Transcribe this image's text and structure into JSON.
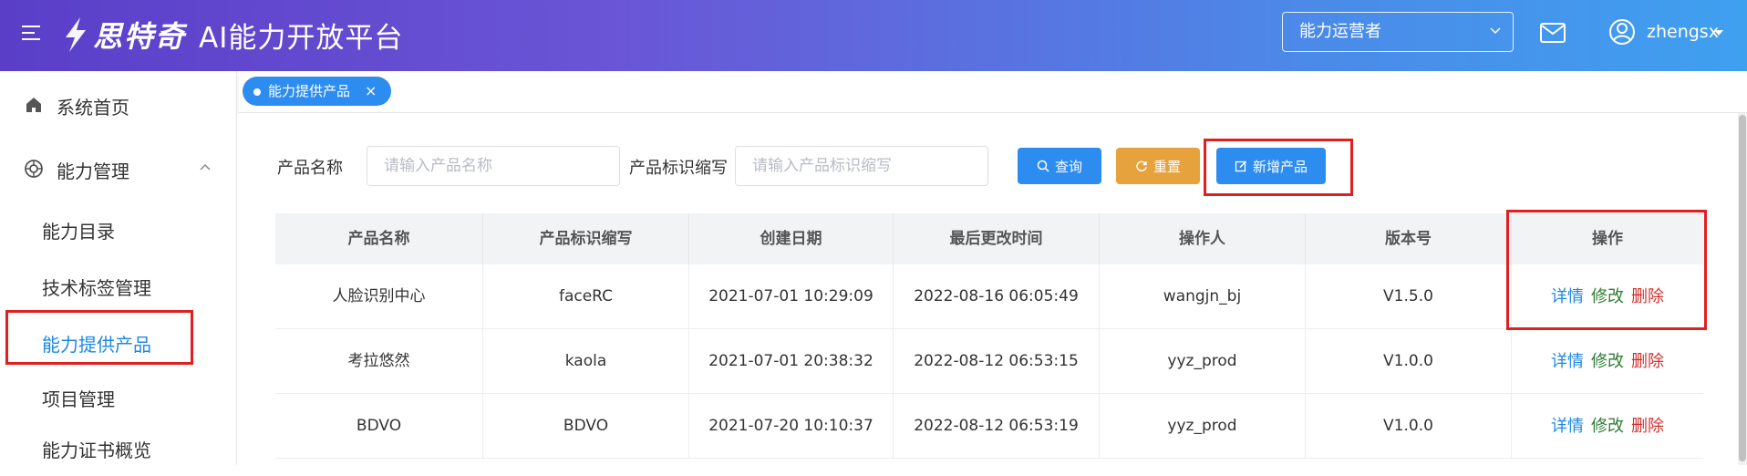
{
  "header": {
    "brand": "思特奇",
    "platform": "AI能力开放平台",
    "role_select": "能力运营者",
    "username": "zhengsx"
  },
  "sidebar": {
    "items": [
      {
        "label": "系统首页",
        "icon": "home-icon"
      },
      {
        "label": "能力管理",
        "icon": "capability-icon"
      }
    ],
    "sub_items": [
      {
        "label": "能力目录"
      },
      {
        "label": "技术标签管理"
      },
      {
        "label": "能力提供产品"
      },
      {
        "label": "项目管理"
      },
      {
        "label": "能力证书概览"
      }
    ]
  },
  "tabs": [
    {
      "label": "能力提供产品",
      "close": "×"
    }
  ],
  "search": {
    "name_label": "产品名称",
    "name_placeholder": "请输入产品名称",
    "abbr_label": "产品标识缩写",
    "abbr_placeholder": "请输入产品标识缩写",
    "query_btn": "查询",
    "reset_btn": "重置",
    "add_btn": "新增产品"
  },
  "table": {
    "columns": [
      "产品名称",
      "产品标识缩写",
      "创建日期",
      "最后更改时间",
      "操作人",
      "版本号",
      "操作"
    ],
    "rows": [
      {
        "name": "人脸识别中心",
        "abbr": "faceRC",
        "created": "2021-07-01 10:29:09",
        "modified": "2022-08-16 06:05:49",
        "operator": "wangjn_bj",
        "version": "V1.5.0"
      },
      {
        "name": "考拉悠然",
        "abbr": "kaola",
        "created": "2021-07-01 20:38:32",
        "modified": "2022-08-12 06:53:15",
        "operator": "yyz_prod",
        "version": "V1.0.0"
      },
      {
        "name": "BDVO",
        "abbr": "BDVO",
        "created": "2021-07-20 10:10:37",
        "modified": "2022-08-12 06:53:19",
        "operator": "yyz_prod",
        "version": "V1.0.0"
      }
    ],
    "actions": {
      "detail": "详情",
      "edit": "修改",
      "delete": "删除"
    }
  },
  "colors": {
    "primary": "#2d8cf0",
    "reset": "#e6a23c",
    "annotation": "#e02020"
  }
}
